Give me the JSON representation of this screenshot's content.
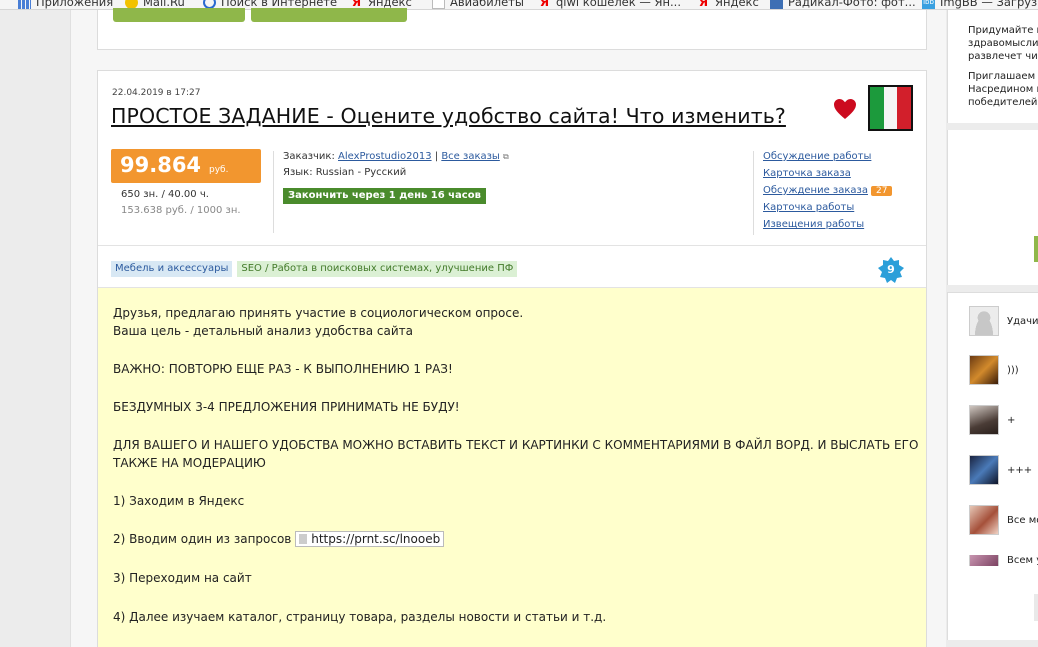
{
  "bookmarks": [
    {
      "label": "Приложения",
      "icon": "apps-icon"
    },
    {
      "label": "Mail.Ru",
      "icon": "mailru-icon"
    },
    {
      "label": "Поиск в Интернете",
      "icon": "search-icon"
    },
    {
      "label": "Яндекс",
      "icon": "yandex-icon"
    },
    {
      "label": "Авиабилеты",
      "icon": "page-icon"
    },
    {
      "label": "qiwi кошелек — Ян...",
      "icon": "yandex-icon"
    },
    {
      "label": "Яндекс",
      "icon": "yandex-icon"
    },
    {
      "label": "Радикал-Фото: фот...",
      "icon": "radikal-icon"
    },
    {
      "label": "ImgBB — Загрузи",
      "icon": "imgbb-icon"
    }
  ],
  "task": {
    "date": "22.04.2019 в 17:27",
    "title": "ПРОСТОЕ ЗАДАНИЕ - Оцените удобство сайта! Что изменить?",
    "price": "99.864",
    "currency": "руб.",
    "stat_line1": "650 зн. / 40.00 ч.",
    "stat_line2": "153.638 руб. / 1000 зн.",
    "customer_label": "Заказчик:",
    "customer_name": "AlexProstudio2013",
    "all_orders": "Все заказы",
    "language_label": "Язык:",
    "language_value": "Russian - Русский",
    "deadline": "Закончить через 1 день 16 часов",
    "links": [
      "Обсуждение работы",
      "Карточка заказа",
      "Обсуждение заказа",
      "Карточка работы",
      "Извещения работы"
    ],
    "discussion_count": "27",
    "tags": [
      "Мебель и аксессуары",
      "SEO / Работа в поисковых системах, улучшение ПФ"
    ],
    "count_badge": "9",
    "colors": {
      "price": "#f2962f",
      "deadline": "#4a8b2c",
      "link": "#2c5a9e",
      "heart": "#cc0a1e",
      "description_bg": "#ffffcc"
    }
  },
  "description": {
    "line1": "Друзья, предлагаю принять участие в социологическом опросе.",
    "line2": "Ваша цель - детальный анализ удобства сайта",
    "line3": "ВАЖНО: ПОВТОРЮ ЕЩЕ РАЗ - К ВЫПОЛНЕНИЮ 1 РАЗ!",
    "line4": "БЕЗДУМНЫХ 3-4 ПРЕДЛОЖЕНИЯ ПРИНИМАТЬ НЕ БУДУ!",
    "line5": "ДЛЯ ВАШЕГО И НАШЕГО УДОБСТВА МОЖНО ВСТАВИТЬ ТЕКСТ И КАРТИНКИ С КОММЕНТАРИЯМИ В ФАЙЛ ВОРД. И ВЫСЛАТЬ ЕГО",
    "line6": "ТАКЖЕ НА МОДЕРАЦИЮ",
    "step1": "1) Заходим в Яндекс",
    "step2": "2) Вводим один из запросов",
    "step2_link": "https://prnt.sc/lnooeb",
    "step3": "3) Переходим на сайт",
    "step4": "4) Далее изучаем каталог, страницу товара, разделы новости и статьи и т.д."
  },
  "sidebar": {
    "text_lines": [
      "Придумайте и",
      "здравомыслин",
      "развлечет чит",
      "Приглашаем п",
      "Насредином н",
      "победителей з"
    ],
    "comments": [
      {
        "text": "Удачи"
      },
      {
        "text": ")))"
      },
      {
        "text": "+"
      },
      {
        "text": "+++"
      },
      {
        "text": "Все мо"
      },
      {
        "text": "Всем у"
      }
    ]
  }
}
